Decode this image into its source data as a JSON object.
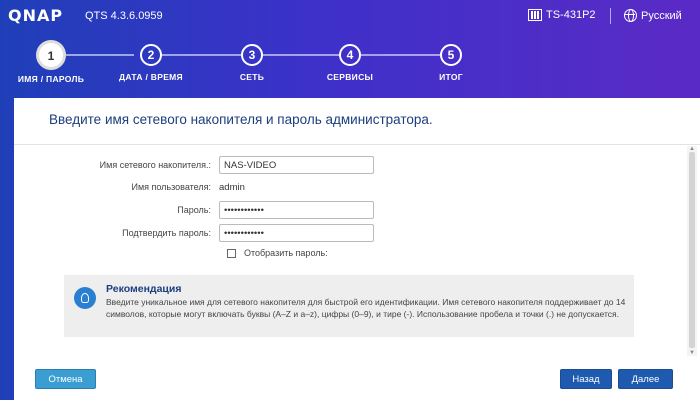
{
  "header": {
    "logo": "QNAP",
    "version": "QTS 4.3.6.0959",
    "device": "TS-431P2",
    "language": "Русский"
  },
  "steps": [
    {
      "num": "1",
      "label": "ИМЯ / ПАРОЛЬ"
    },
    {
      "num": "2",
      "label": "ДАТА / ВРЕМЯ"
    },
    {
      "num": "3",
      "label": "СЕТЬ"
    },
    {
      "num": "4",
      "label": "СЕРВИСЫ"
    },
    {
      "num": "5",
      "label": "ИТОГ"
    }
  ],
  "panel": {
    "title": "Введите имя сетевого накопителя и пароль администратора."
  },
  "form": {
    "nas_name_label": "Имя сетевого накопителя.:",
    "nas_name_value": "NAS-VIDEO",
    "username_label": "Имя пользователя:",
    "username_value": "admin",
    "password_label": "Пароль:",
    "password_value": "••••••••••••",
    "confirm_label": "Подтвердить пароль:",
    "confirm_value": "••••••••••••",
    "show_password_label": "Отобразить пароль:"
  },
  "tip": {
    "title": "Рекомендация",
    "text": "Введите уникальное имя для сетевого накопителя для быстрой его идентификации. Имя сетевого накопителя поддерживает до 14 символов, которые могут включать буквы (A–Z и a–z), цифры (0–9), и тире (-). Использование пробела и точки (.) не допускается."
  },
  "buttons": {
    "cancel": "Отмена",
    "back": "Назад",
    "next": "Далее"
  }
}
